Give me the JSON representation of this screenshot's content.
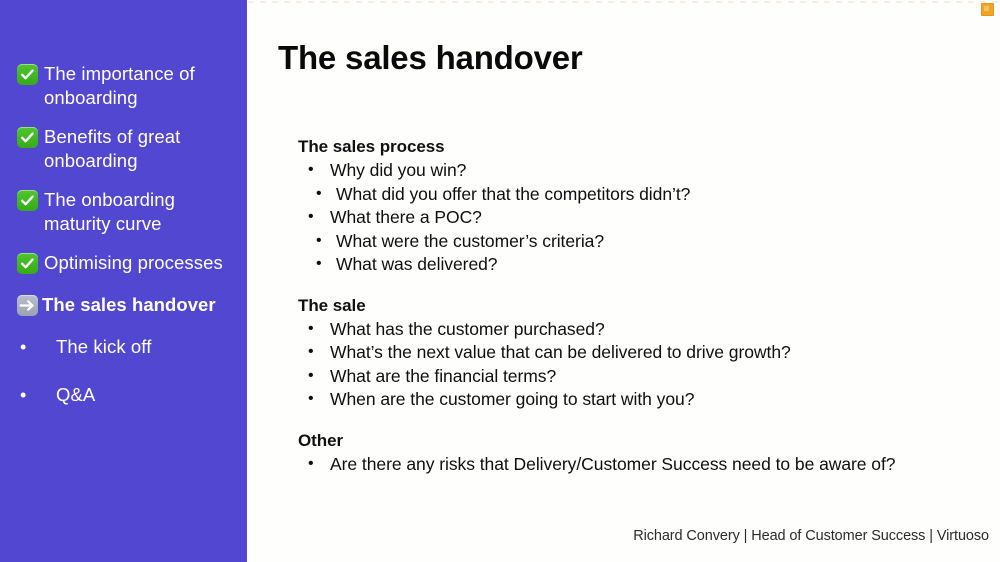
{
  "slide": {
    "title": "The sales handover",
    "accent_purple": "#5247d0",
    "check_green": "#42b71f",
    "arrow_gray": "#a8b0bd",
    "corner_mark_color": "#f0a429",
    "footer": "Richard Convery | Head of Customer Success | Virtuoso"
  },
  "sidebar": {
    "items": [
      {
        "label": "The importance of\nonboarding",
        "icon": "white-check-mark-icon",
        "state": "done"
      },
      {
        "label": "Benefits of great\nonboarding",
        "icon": "white-check-mark-icon",
        "state": "done"
      },
      {
        "label": "The onboarding\nmaturity curve",
        "icon": "white-check-mark-icon",
        "state": "done"
      },
      {
        "label": "Optimising processes",
        "icon": "white-check-mark-icon",
        "state": "done"
      },
      {
        "label": "The sales handover",
        "icon": "right-arrow-icon",
        "state": "current"
      },
      {
        "label": "The kick off",
        "icon": "bullet-dot-icon",
        "state": "upcoming"
      },
      {
        "label": "Q&A",
        "icon": "bullet-dot-icon",
        "state": "upcoming"
      }
    ]
  },
  "content": {
    "blocks": [
      {
        "heading": "The sales process",
        "bullets": [
          {
            "text": "Why did you win?",
            "children": [
              "What did you offer that the competitors didn’t?"
            ]
          },
          {
            "text": "What there a POC?",
            "children": [
              "What were the customer’s criteria?",
              "What was delivered?"
            ]
          }
        ]
      },
      {
        "heading": "The sale",
        "bullets": [
          {
            "text": "What has the customer purchased?",
            "children": []
          },
          {
            "text": "What’s the next value that can be delivered to drive growth?",
            "children": []
          },
          {
            "text": "What are the financial terms?",
            "children": []
          },
          {
            "text": "When are the customer going to start with you?",
            "children": []
          }
        ]
      },
      {
        "heading": "Other",
        "bullets": [
          {
            "text": "Are there any risks that Delivery/Customer Success need to be aware of?",
            "children": []
          }
        ]
      }
    ]
  }
}
